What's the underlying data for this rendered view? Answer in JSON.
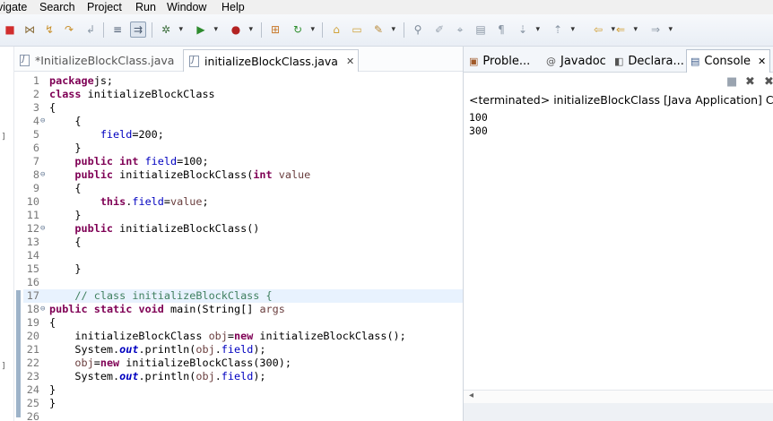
{
  "menu": [
    "vigate",
    "Search",
    "Project",
    "Run",
    "Window",
    "Help"
  ],
  "toolbar_icons": [
    "stop-icon",
    "skip-breakpoints-icon",
    "step-into-icon",
    "step-over-icon",
    "step-return-icon",
    "toggle-icon",
    "debug-icon",
    "run-icon",
    "run-external-icon",
    "new-class-icon",
    "refresh-icon",
    "open-folder-icon",
    "open-type-icon",
    "search-icon",
    "pin-icon",
    "edit-icon",
    "mark-icon",
    "annotation-icon",
    "nav-prev-icon",
    "nav-next-icon",
    "back-icon",
    "forward-icon"
  ],
  "editor": {
    "tabs": [
      {
        "label": "*InitializeBlockClass.java",
        "active": false
      },
      {
        "label": "initializeBlockClass.java",
        "active": true,
        "close": "✕"
      }
    ],
    "lines": [
      {
        "n": "1",
        "fold": "",
        "html_parts": [
          [
            "kw",
            "package"
          ],
          [
            "",
            "js;"
          ]
        ]
      },
      {
        "n": "2",
        "fold": "",
        "html_parts": [
          [
            "kw",
            "class"
          ],
          [
            "",
            " initializeBlockClass"
          ]
        ]
      },
      {
        "n": "3",
        "fold": "",
        "html_parts": [
          [
            "",
            "{"
          ]
        ]
      },
      {
        "n": "4",
        "fold": "⊖",
        "html_parts": [
          [
            "",
            "    {"
          ]
        ]
      },
      {
        "n": "5",
        "fold": "",
        "html_parts": [
          [
            "",
            "        "
          ],
          [
            "fld",
            "field"
          ],
          [
            "",
            "=200;"
          ]
        ]
      },
      {
        "n": "6",
        "fold": "",
        "html_parts": [
          [
            "",
            "    }"
          ]
        ]
      },
      {
        "n": "7",
        "fold": "",
        "html_parts": [
          [
            "",
            "    "
          ],
          [
            "kw",
            "public"
          ],
          [
            "",
            " "
          ],
          [
            "kw",
            "int"
          ],
          [
            "",
            " "
          ],
          [
            "fld",
            "field"
          ],
          [
            "",
            "=100;"
          ]
        ]
      },
      {
        "n": "8",
        "fold": "⊖",
        "html_parts": [
          [
            "",
            "    "
          ],
          [
            "kw",
            "public"
          ],
          [
            "",
            " initializeBlockClass("
          ],
          [
            "kw",
            "int"
          ],
          [
            "",
            " "
          ],
          [
            "var",
            "value"
          ],
          [
            ")"
          ]
        ]
      },
      {
        "n": "9",
        "fold": "",
        "html_parts": [
          [
            "",
            "    {"
          ]
        ]
      },
      {
        "n": "10",
        "fold": "",
        "html_parts": [
          [
            "",
            "        "
          ],
          [
            "kw",
            "this"
          ],
          [
            "",
            "."
          ],
          [
            "fld",
            "field"
          ],
          [
            "",
            "="
          ],
          [
            "var",
            "value"
          ],
          [
            "",
            ";"
          ]
        ]
      },
      {
        "n": "11",
        "fold": "",
        "html_parts": [
          [
            "",
            "    }"
          ]
        ]
      },
      {
        "n": "12",
        "fold": "⊖",
        "html_parts": [
          [
            "",
            "    "
          ],
          [
            "kw",
            "public"
          ],
          [
            "",
            " initializeBlockClass()"
          ]
        ]
      },
      {
        "n": "13",
        "fold": "",
        "html_parts": [
          [
            "",
            "    {"
          ]
        ]
      },
      {
        "n": "14",
        "fold": "",
        "html_parts": [
          [
            "",
            ""
          ]
        ]
      },
      {
        "n": "15",
        "fold": "",
        "html_parts": [
          [
            "",
            "    }"
          ]
        ]
      },
      {
        "n": "16",
        "fold": "",
        "html_parts": [
          [
            "",
            ""
          ]
        ]
      },
      {
        "n": "17",
        "fold": "",
        "current": true,
        "html_parts": [
          [
            "",
            "    "
          ],
          [
            "cm",
            "// class initializeBlockClass {"
          ]
        ]
      },
      {
        "n": "18",
        "fold": "⊖",
        "html_parts": [
          [
            "kw",
            "public"
          ],
          [
            "",
            " "
          ],
          [
            "kw",
            "static"
          ],
          [
            "",
            " "
          ],
          [
            "kw",
            "void"
          ],
          [
            "",
            " main(String[] "
          ],
          [
            "var",
            "args"
          ],
          [
            ")"
          ]
        ]
      },
      {
        "n": "19",
        "fold": "",
        "html_parts": [
          [
            "",
            "{"
          ]
        ]
      },
      {
        "n": "20",
        "fold": "",
        "html_parts": [
          [
            "",
            "    initializeBlockClass "
          ],
          [
            "var",
            "obj"
          ],
          [
            "",
            "="
          ],
          [
            "kw",
            "new"
          ],
          [
            "",
            " initializeBlockClass();"
          ]
        ]
      },
      {
        "n": "21",
        "fold": "",
        "html_parts": [
          [
            "",
            "    System."
          ],
          [
            "fld-i",
            "out"
          ],
          [
            "",
            ".println("
          ],
          [
            "var",
            "obj"
          ],
          [
            "",
            "."
          ],
          [
            "fld",
            "field"
          ],
          [
            "",
            ");"
          ]
        ]
      },
      {
        "n": "22",
        "fold": "",
        "html_parts": [
          [
            "",
            "    "
          ],
          [
            "var",
            "obj"
          ],
          [
            "",
            "="
          ],
          [
            "kw",
            "new"
          ],
          [
            "",
            " initializeBlockClass(300);"
          ]
        ]
      },
      {
        "n": "23",
        "fold": "",
        "html_parts": [
          [
            "",
            "    System."
          ],
          [
            "fld-i",
            "out"
          ],
          [
            "",
            ".println("
          ],
          [
            "var",
            "obj"
          ],
          [
            "",
            "."
          ],
          [
            "fld",
            "field"
          ],
          [
            "",
            ");"
          ]
        ]
      },
      {
        "n": "24",
        "fold": "",
        "html_parts": [
          [
            "",
            "}"
          ]
        ]
      },
      {
        "n": "25",
        "fold": "",
        "html_parts": [
          [
            "",
            "}"
          ]
        ]
      },
      {
        "n": "26",
        "fold": "",
        "html_parts": [
          [
            "",
            ""
          ]
        ]
      }
    ]
  },
  "console": {
    "tabs": [
      {
        "label": "Proble...",
        "icon": "problems-icon",
        "glyph": "▣"
      },
      {
        "label": "Javadoc",
        "icon": "javadoc-icon",
        "glyph": "@"
      },
      {
        "label": "Declara...",
        "icon": "declaration-icon",
        "glyph": "◧"
      },
      {
        "label": "Console",
        "icon": "console-icon",
        "glyph": "▤",
        "active": true,
        "close": "✕"
      }
    ],
    "status": "<terminated> initializeBlockClass [Java Application] C:\\Pro",
    "output": [
      "100",
      "300"
    ],
    "scroll_glyph": "◂"
  },
  "colors": {
    "keyword": "#7f0055",
    "field": "#0000c0",
    "comment": "#3f7f5f",
    "variable": "#6a3e3e"
  }
}
